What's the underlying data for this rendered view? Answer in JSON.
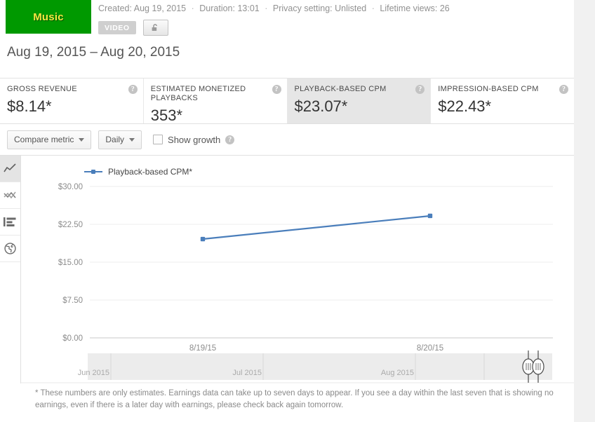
{
  "video": {
    "thumbnail_label": "Music",
    "thumbnail_color": "#009900",
    "meta": {
      "created_label": "Created: Aug 19, 2015",
      "duration_label": "Duration: 13:01",
      "privacy_label": "Privacy setting: Unlisted",
      "lifetime_views_label": "Lifetime views: 26",
      "separator": "·"
    },
    "type_badge": "VIDEO",
    "lock_icon": "unlock-icon"
  },
  "date_range": "Aug 19, 2015 – Aug 20, 2015",
  "cards": [
    {
      "label": "GROSS REVENUE",
      "value": "$8.14*",
      "selected": false,
      "help": "?"
    },
    {
      "label": "ESTIMATED MONETIZED PLAYBACKS",
      "value": "353*",
      "selected": false,
      "help": "?"
    },
    {
      "label": "PLAYBACK-BASED CPM",
      "value": "$23.07*",
      "selected": true,
      "help": "?"
    },
    {
      "label": "IMPRESSION-BASED CPM",
      "value": "$22.43*",
      "selected": false,
      "help": "?"
    }
  ],
  "toolbar": {
    "compare_metric_label": "Compare metric",
    "interval_label": "Daily",
    "show_growth_label": "Show growth",
    "show_growth_checked": false,
    "help": "?"
  },
  "sidebar": {
    "items": [
      {
        "icon": "line-chart-icon",
        "active": true
      },
      {
        "icon": "multiline-chart-icon",
        "active": false
      },
      {
        "icon": "bar-chart-icon",
        "active": false
      },
      {
        "icon": "globe-icon",
        "active": false
      }
    ]
  },
  "chart_data": {
    "type": "line",
    "title": "",
    "series": [
      {
        "name": "Playback-based CPM*",
        "color": "#4a7ebb",
        "x": [
          "8/19/15",
          "8/20/15"
        ],
        "values": [
          19.58,
          24.17
        ]
      }
    ],
    "categories": [
      "8/19/15",
      "8/20/15"
    ],
    "xlabel": "",
    "ylabel": "",
    "ylim": [
      0,
      30
    ],
    "yticks": [
      30.0,
      22.5,
      15.0,
      7.5,
      0.0
    ],
    "ytick_labels": [
      "$30.00",
      "$22.50",
      "$15.00",
      "$7.50",
      "$0.00"
    ],
    "xtick_labels": [
      "8/19/15",
      "8/20/15"
    ],
    "grid": true,
    "legend_position": "top-left"
  },
  "timeline": {
    "labels": [
      "Jun 2015",
      "Jul 2015",
      "Aug 2015"
    ],
    "handle_left": "range-handle-left",
    "handle_right": "range-handle-right"
  },
  "footnote": "* These numbers are only estimates. Earnings data can take up to seven days to appear. If you see a day within the last seven that is showing no earnings, even if there is a later day with earnings, please check back again tomorrow."
}
